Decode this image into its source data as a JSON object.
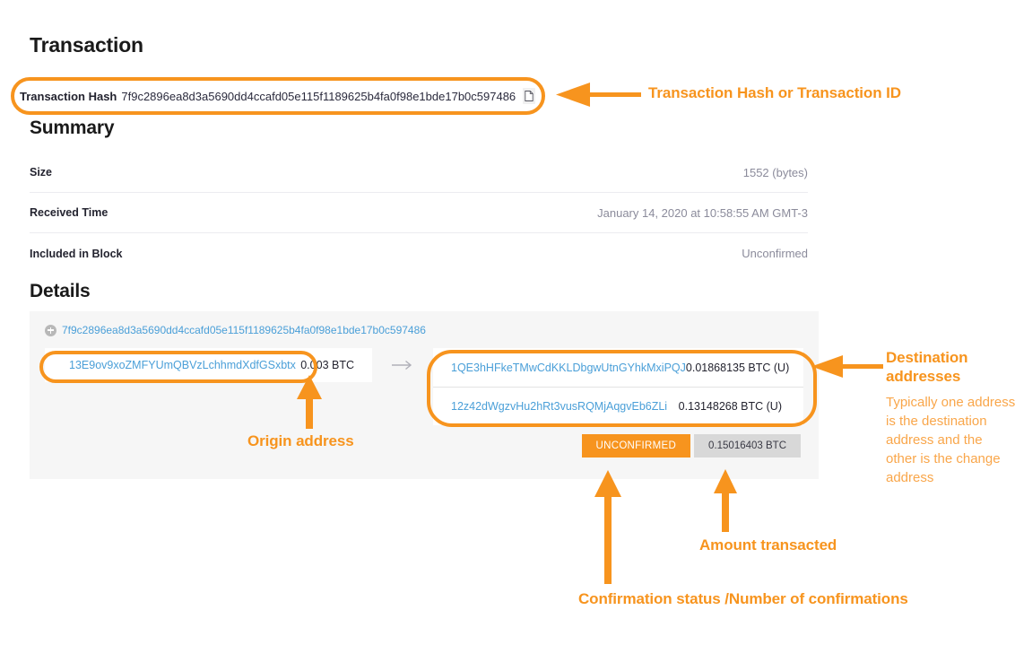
{
  "page": {
    "title": "Transaction",
    "summary_heading": "Summary",
    "details_heading": "Details"
  },
  "transaction_hash": {
    "label": "Transaction Hash",
    "value": "7f9c2896ea8d3a5690dd4ccafd05e115f1189625b4fa0f98e1bde17b0c597486",
    "copy_icon": "copy-document-icon"
  },
  "summary": {
    "rows": [
      {
        "key": "Size",
        "value": "1552 (bytes)"
      },
      {
        "key": "Received Time",
        "value": "January 14, 2020 at 10:58:55 AM GMT-3"
      },
      {
        "key": "Included in Block",
        "value": "Unconfirmed"
      }
    ]
  },
  "details": {
    "hash": "7f9c2896ea8d3a5690dd4ccafd05e115f1189625b4fa0f98e1bde17b0c597486",
    "expand_icon": "plus-circle-icon",
    "flow_icon": "arrow-right-icon",
    "inputs": [
      {
        "address": "13E9ov9xoZMFYUmQBVzLchhmdXdfGSxbtx",
        "amount": "0.003 BTC"
      }
    ],
    "outputs": [
      {
        "address": "1QE3hHFkeTMwCdKKLDbgwUtnGYhkMxiPQJ",
        "amount": "0.01868135 BTC (U)"
      },
      {
        "address": "12z42dWgzvHu2hRt3vusRQMjAqgvEb6ZLi",
        "amount": "0.13148268 BTC (U)"
      }
    ],
    "status_badge": "UNCONFIRMED",
    "total_badge": "0.15016403 BTC"
  },
  "annotations": {
    "tx_hash": "Transaction Hash or Transaction ID",
    "origin": "Origin address",
    "destination_title": "Destination addresses",
    "destination_body": "Typically one address is the destination address and the other is the change address",
    "amount": "Amount transacted",
    "confirmation": "Confirmation status /Number of confirmations"
  },
  "colors": {
    "accent": "#f7941e",
    "link": "#4a9fd8",
    "panel": "#f6f6f6",
    "badge_gray": "#d8d8d8",
    "muted_text": "#8b8b9b"
  }
}
